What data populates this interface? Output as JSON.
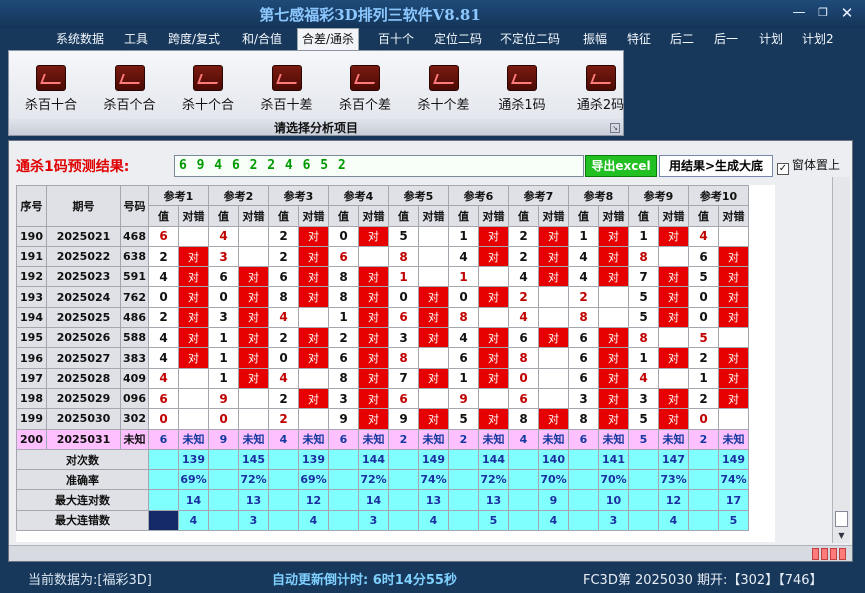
{
  "window": {
    "title": "第七感福彩3D排列三软件V8.81"
  },
  "menu": [
    "系统数据",
    "工具",
    "跨度/复式",
    "和/合值",
    "合差/通杀",
    "百十个",
    "定位二码",
    "不定位二码",
    "振幅",
    "特征",
    "后二",
    "后一",
    "计划",
    "计划2"
  ],
  "menu_active_index": 4,
  "ribbon": {
    "tools": [
      "杀百十合",
      "杀百个合",
      "杀十个合",
      "杀百十差",
      "杀百个差",
      "杀十个差",
      "通杀1码",
      "通杀2码"
    ],
    "caption": "请选择分析项目"
  },
  "prediction": {
    "label": "通杀1码预测结果:",
    "value": "6 9 4 6 2 2 4 6 5 2",
    "export_label": "导出excel",
    "generate_label": "用结果>生成大底",
    "ontop_label": "窗体置上",
    "ontop_checked": "✓"
  },
  "table": {
    "headers": {
      "seq": "序号",
      "period": "期号",
      "number": "号码",
      "refs": [
        "参考1",
        "参考2",
        "参考3",
        "参考4",
        "参考5",
        "参考6",
        "参考7",
        "参考8",
        "参考9",
        "参考10"
      ],
      "value": "值",
      "correct": "对错"
    },
    "hit_mark": "对",
    "rows": [
      {
        "seq": "190",
        "period": "2025021",
        "number": "468",
        "v": [
          "6",
          "4",
          "2",
          "0",
          "5",
          "1",
          "2",
          "1",
          "1",
          "4"
        ],
        "hit": [
          0,
          0,
          1,
          1,
          0,
          1,
          1,
          1,
          1,
          0
        ],
        "red": [
          1,
          1,
          0,
          0,
          0,
          0,
          0,
          0,
          0,
          1
        ]
      },
      {
        "seq": "191",
        "period": "2025022",
        "number": "638",
        "v": [
          "2",
          "3",
          "2",
          "6",
          "8",
          "4",
          "2",
          "4",
          "8",
          "6"
        ],
        "hit": [
          1,
          0,
          1,
          0,
          0,
          1,
          1,
          1,
          0,
          1
        ],
        "red": [
          0,
          1,
          0,
          1,
          1,
          0,
          0,
          0,
          1,
          0
        ]
      },
      {
        "seq": "192",
        "period": "2025023",
        "number": "591",
        "v": [
          "4",
          "6",
          "6",
          "8",
          "1",
          "1",
          "4",
          "4",
          "7",
          "5"
        ],
        "hit": [
          1,
          1,
          1,
          1,
          0,
          0,
          1,
          1,
          1,
          1
        ],
        "red": [
          0,
          0,
          0,
          0,
          1,
          1,
          0,
          0,
          0,
          0
        ]
      },
      {
        "seq": "193",
        "period": "2025024",
        "number": "762",
        "v": [
          "0",
          "0",
          "8",
          "8",
          "0",
          "0",
          "2",
          "2",
          "5",
          "0"
        ],
        "hit": [
          1,
          1,
          1,
          1,
          1,
          1,
          0,
          0,
          1,
          1
        ],
        "red": [
          0,
          0,
          0,
          0,
          0,
          0,
          1,
          1,
          0,
          0
        ]
      },
      {
        "seq": "194",
        "period": "2025025",
        "number": "486",
        "v": [
          "2",
          "3",
          "4",
          "1",
          "6",
          "8",
          "4",
          "8",
          "5",
          "0"
        ],
        "hit": [
          1,
          1,
          0,
          1,
          1,
          0,
          0,
          0,
          1,
          1
        ],
        "red": [
          0,
          0,
          1,
          0,
          1,
          1,
          1,
          1,
          0,
          0
        ]
      },
      {
        "seq": "195",
        "period": "2025026",
        "number": "588",
        "v": [
          "4",
          "1",
          "2",
          "2",
          "3",
          "4",
          "6",
          "6",
          "8",
          "5"
        ],
        "hit": [
          1,
          1,
          1,
          1,
          1,
          1,
          1,
          1,
          0,
          0
        ],
        "red": [
          0,
          0,
          0,
          0,
          0,
          0,
          0,
          0,
          1,
          1
        ]
      },
      {
        "seq": "196",
        "period": "2025027",
        "number": "383",
        "v": [
          "4",
          "1",
          "0",
          "6",
          "8",
          "6",
          "8",
          "6",
          "1",
          "2"
        ],
        "hit": [
          1,
          1,
          1,
          1,
          0,
          1,
          0,
          1,
          1,
          1
        ],
        "red": [
          0,
          0,
          0,
          0,
          1,
          0,
          1,
          0,
          0,
          0
        ]
      },
      {
        "seq": "197",
        "period": "2025028",
        "number": "409",
        "v": [
          "4",
          "1",
          "4",
          "8",
          "7",
          "1",
          "0",
          "6",
          "4",
          "1"
        ],
        "hit": [
          0,
          1,
          0,
          1,
          1,
          1,
          0,
          1,
          0,
          1
        ],
        "red": [
          1,
          0,
          1,
          0,
          0,
          0,
          1,
          0,
          1,
          0
        ]
      },
      {
        "seq": "198",
        "period": "2025029",
        "number": "096",
        "v": [
          "6",
          "9",
          "2",
          "3",
          "6",
          "9",
          "6",
          "3",
          "3",
          "2"
        ],
        "hit": [
          0,
          0,
          1,
          1,
          0,
          0,
          0,
          1,
          1,
          1
        ],
        "red": [
          1,
          1,
          0,
          0,
          1,
          1,
          1,
          0,
          0,
          0
        ]
      },
      {
        "seq": "199",
        "period": "2025030",
        "number": "302",
        "v": [
          "0",
          "0",
          "2",
          "9",
          "9",
          "5",
          "8",
          "8",
          "5",
          "0"
        ],
        "hit": [
          0,
          0,
          0,
          1,
          1,
          1,
          1,
          1,
          1,
          0
        ],
        "red": [
          1,
          1,
          1,
          0,
          0,
          0,
          0,
          0,
          0,
          1
        ]
      }
    ],
    "pending": {
      "seq": "200",
      "period": "2025031",
      "number": "未知",
      "v": [
        "6",
        "9",
        "4",
        "6",
        "2",
        "2",
        "4",
        "6",
        "5",
        "2"
      ],
      "mark": "未知"
    },
    "stats": [
      {
        "label": "对次数",
        "values": [
          "139",
          "145",
          "139",
          "144",
          "149",
          "144",
          "140",
          "141",
          "147",
          "149"
        ]
      },
      {
        "label": "准确率",
        "values": [
          "69%",
          "72%",
          "69%",
          "72%",
          "74%",
          "72%",
          "70%",
          "70%",
          "73%",
          "74%"
        ]
      },
      {
        "label": "最大连对数",
        "values": [
          "14",
          "13",
          "12",
          "14",
          "13",
          "13",
          "9",
          "10",
          "12",
          "17"
        ]
      },
      {
        "label": "最大连错数",
        "values": [
          "4",
          "3",
          "4",
          "3",
          "4",
          "5",
          "4",
          "3",
          "4",
          "5"
        ]
      }
    ]
  },
  "status": {
    "data_source": "当前数据为:[福彩3D]",
    "countdown": "自动更新倒计时:  6时14分55秒",
    "issue": "FC3D第 2025030 期开:【302】【746】"
  },
  "colors": {
    "hit": "#e60000",
    "stat_bg": "#80ffff",
    "pending_bg": "#ffc0ff",
    "prediction_text": "#009a00"
  }
}
